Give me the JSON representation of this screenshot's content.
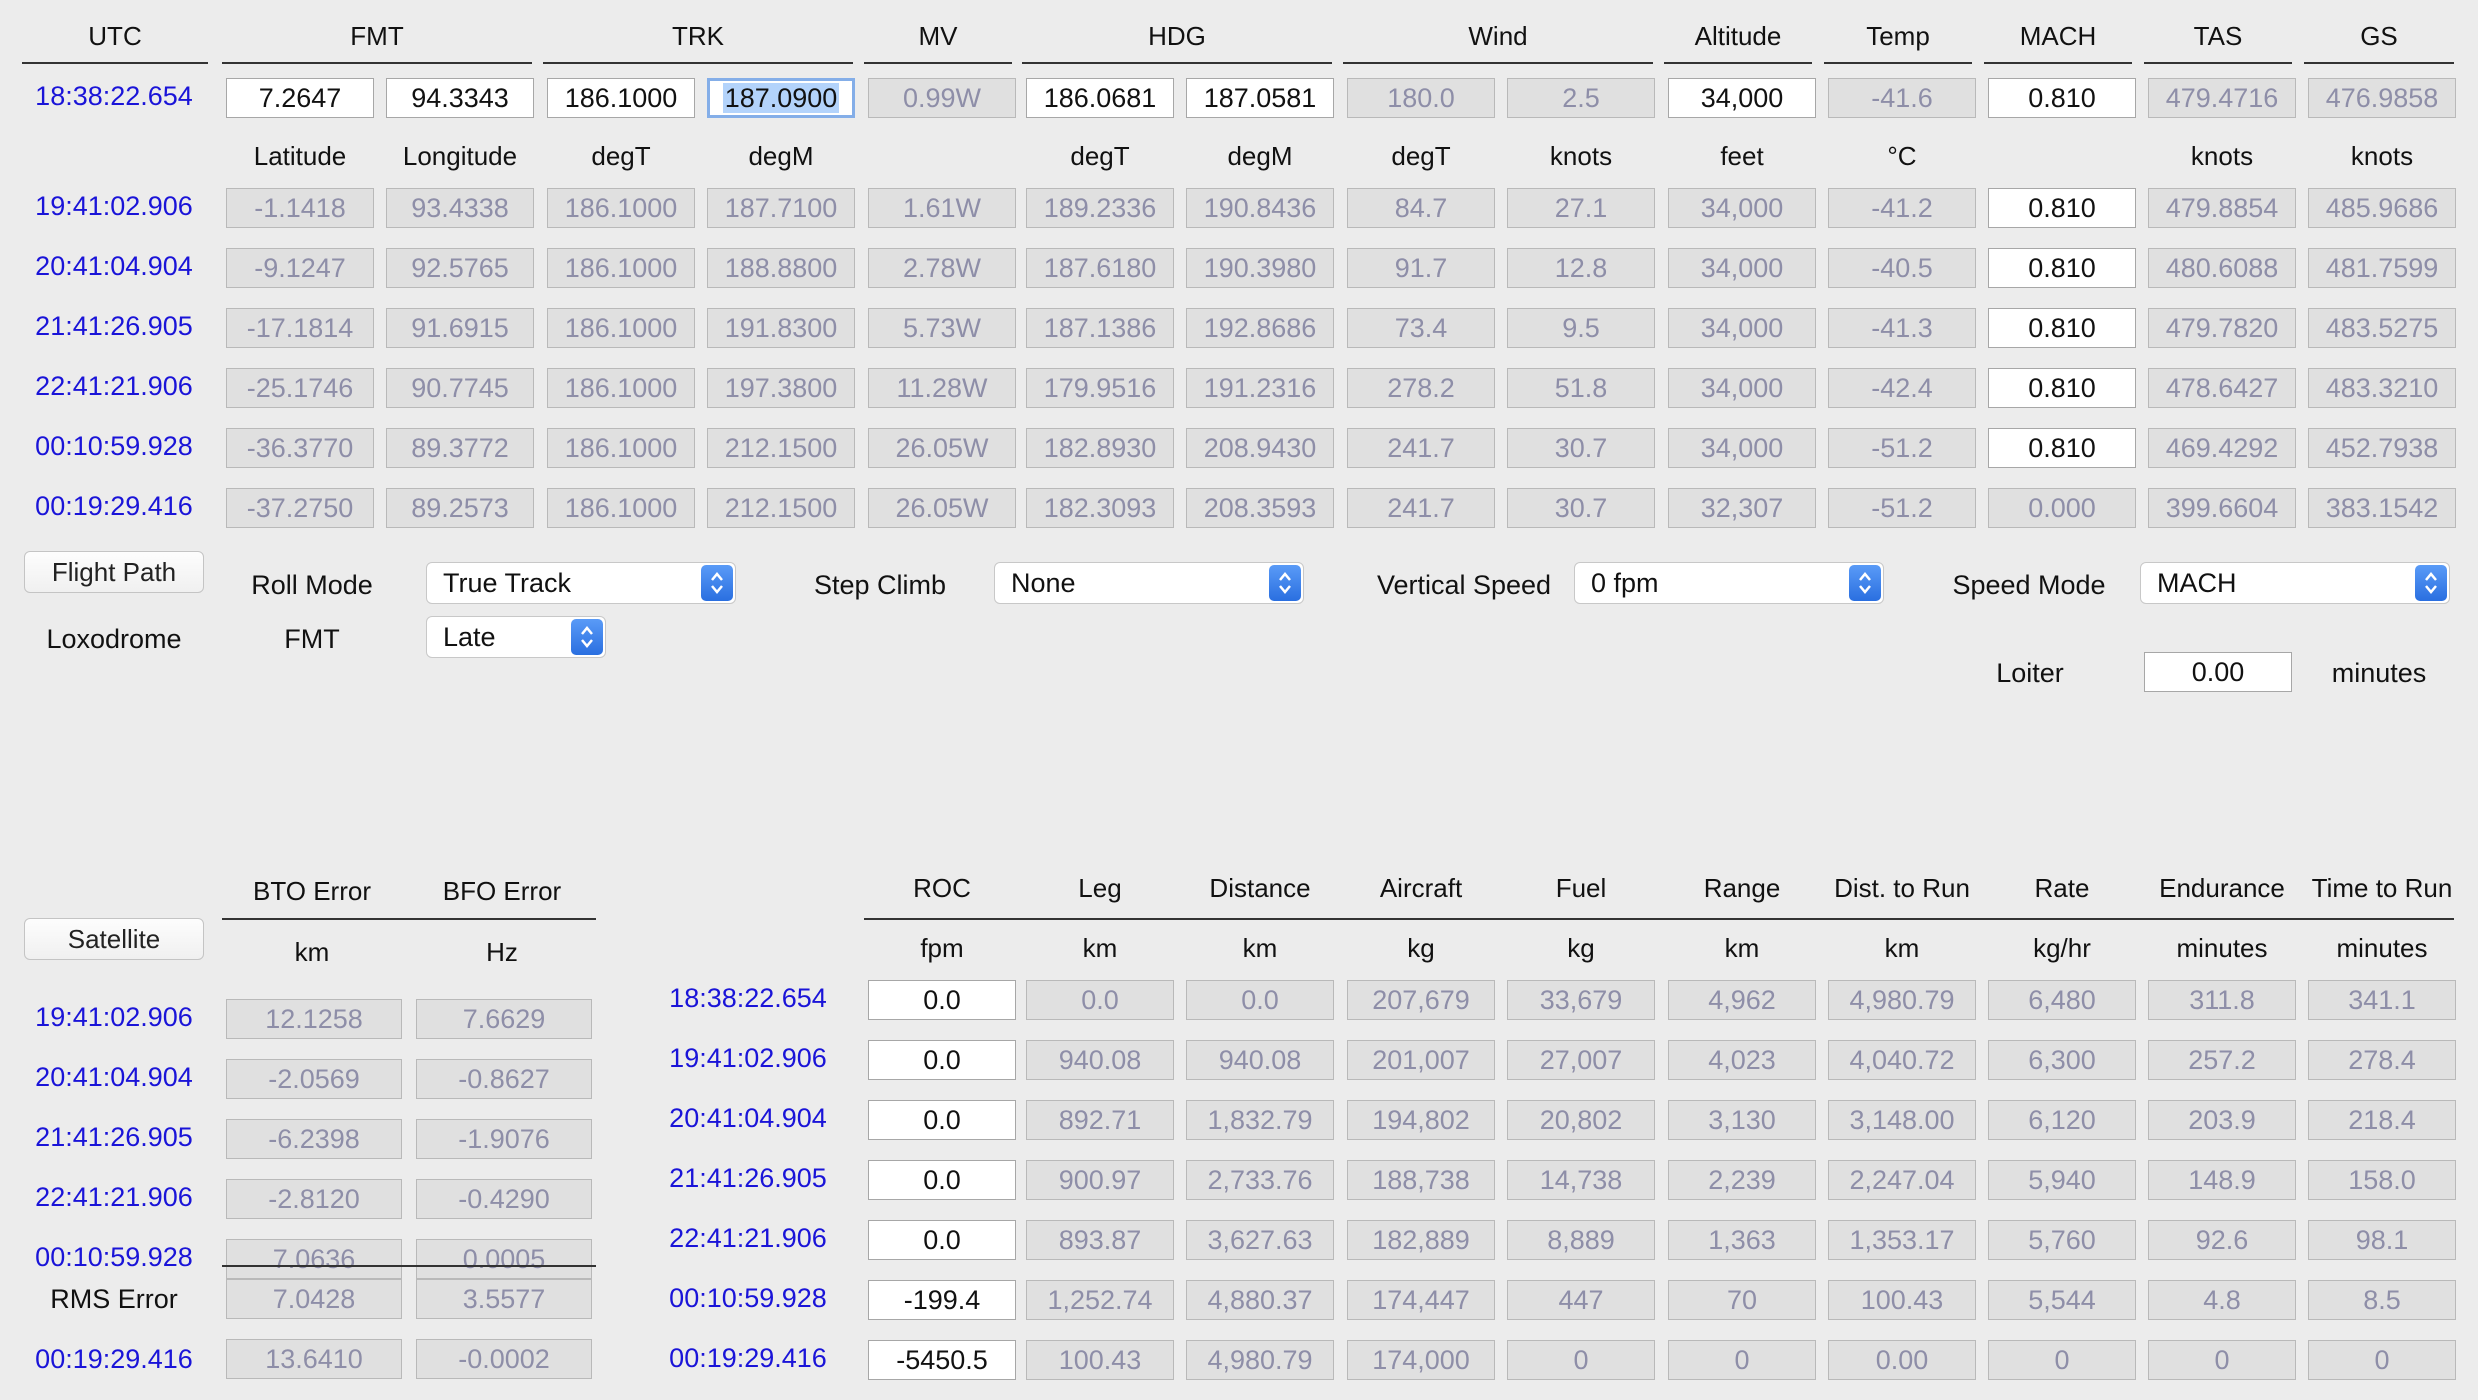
{
  "top_headers": [
    "UTC",
    "FMT",
    "TRK",
    "MV",
    "HDG",
    "Wind",
    "Altitude",
    "Temp",
    "MACH",
    "TAS",
    "GS"
  ],
  "top_units": [
    "Latitude",
    "Longitude",
    "degT",
    "degM",
    "",
    "degT",
    "degM",
    "degT",
    "knots",
    "feet",
    "°C",
    "",
    "knots",
    "knots"
  ],
  "top_rows": [
    {
      "time": "18:38:22.654",
      "cells": [
        "7.2647",
        "94.3343",
        "186.1000",
        "187.0900",
        "0.99W",
        "186.0681",
        "187.0581",
        "180.0",
        "2.5",
        "34,000",
        "-41.6",
        "0.810",
        "479.4716",
        "476.9858"
      ]
    },
    {
      "time": "19:41:02.906",
      "cells": [
        "-1.1418",
        "93.4338",
        "186.1000",
        "187.7100",
        "1.61W",
        "189.2336",
        "190.8436",
        "84.7",
        "27.1",
        "34,000",
        "-41.2",
        "0.810",
        "479.8854",
        "485.9686"
      ]
    },
    {
      "time": "20:41:04.904",
      "cells": [
        "-9.1247",
        "92.5765",
        "186.1000",
        "188.8800",
        "2.78W",
        "187.6180",
        "190.3980",
        "91.7",
        "12.8",
        "34,000",
        "-40.5",
        "0.810",
        "480.6088",
        "481.7599"
      ]
    },
    {
      "time": "21:41:26.905",
      "cells": [
        "-17.1814",
        "91.6915",
        "186.1000",
        "191.8300",
        "5.73W",
        "187.1386",
        "192.8686",
        "73.4",
        "9.5",
        "34,000",
        "-41.3",
        "0.810",
        "479.7820",
        "483.5275"
      ]
    },
    {
      "time": "22:41:21.906",
      "cells": [
        "-25.1746",
        "90.7745",
        "186.1000",
        "197.3800",
        "11.28W",
        "179.9516",
        "191.2316",
        "278.2",
        "51.8",
        "34,000",
        "-42.4",
        "0.810",
        "478.6427",
        "483.3210"
      ]
    },
    {
      "time": "00:10:59.928",
      "cells": [
        "-36.3770",
        "89.3772",
        "186.1000",
        "212.1500",
        "26.05W",
        "182.8930",
        "208.9430",
        "241.7",
        "30.7",
        "34,000",
        "-51.2",
        "0.810",
        "469.4292",
        "452.7938"
      ]
    },
    {
      "time": "00:19:29.416",
      "cells": [
        "-37.2750",
        "89.2573",
        "186.1000",
        "212.1500",
        "26.05W",
        "182.3093",
        "208.3593",
        "241.7",
        "30.7",
        "32,307",
        "-51.2",
        "0.000",
        "399.6604",
        "383.1542"
      ]
    }
  ],
  "controls": {
    "flight_path_button": "Flight Path",
    "loxodrome_label": "Loxodrome",
    "roll_mode_label": "Roll Mode",
    "roll_mode_value": "True Track",
    "fmt_label": "FMT",
    "fmt_value": "Late",
    "step_climb_label": "Step Climb",
    "step_climb_value": "None",
    "vertical_speed_label": "Vertical Speed",
    "vertical_speed_value": "0 fpm",
    "speed_mode_label": "Speed Mode",
    "speed_mode_value": "MACH",
    "loiter_label": "Loiter",
    "loiter_value": "0.00",
    "loiter_unit": "minutes"
  },
  "satellite": {
    "button": "Satellite",
    "headers": [
      "BTO Error",
      "BFO Error"
    ],
    "units": [
      "km",
      "Hz"
    ],
    "rows": [
      {
        "time": "19:41:02.906",
        "cells": [
          "12.1258",
          "7.6629"
        ]
      },
      {
        "time": "20:41:04.904",
        "cells": [
          "-2.0569",
          "-0.8627"
        ]
      },
      {
        "time": "21:41:26.905",
        "cells": [
          "-6.2398",
          "-1.9076"
        ]
      },
      {
        "time": "22:41:21.906",
        "cells": [
          "-2.8120",
          "-0.4290"
        ]
      },
      {
        "time": "00:10:59.928",
        "cells": [
          "7.0636",
          "0.0005"
        ]
      }
    ],
    "rms_label": "RMS Error",
    "rms_cells": [
      "7.0428",
      "3.5577"
    ],
    "last_time": "00:19:29.416",
    "last_cells": [
      "13.6410",
      "-0.0002"
    ]
  },
  "fuel": {
    "headers": [
      "ROC",
      "Leg",
      "Distance",
      "Aircraft",
      "Fuel",
      "Range",
      "Dist. to Run",
      "Rate",
      "Endurance",
      "Time to Run"
    ],
    "units": [
      "fpm",
      "km",
      "km",
      "kg",
      "kg",
      "km",
      "km",
      "kg/hr",
      "minutes",
      "minutes"
    ],
    "rows": [
      {
        "time": "18:38:22.654",
        "cells": [
          "0.0",
          "0.0",
          "0.0",
          "207,679",
          "33,679",
          "4,962",
          "4,980.79",
          "6,480",
          "311.8",
          "341.1"
        ]
      },
      {
        "time": "19:41:02.906",
        "cells": [
          "0.0",
          "940.08",
          "940.08",
          "201,007",
          "27,007",
          "4,023",
          "4,040.72",
          "6,300",
          "257.2",
          "278.4"
        ]
      },
      {
        "time": "20:41:04.904",
        "cells": [
          "0.0",
          "892.71",
          "1,832.79",
          "194,802",
          "20,802",
          "3,130",
          "3,148.00",
          "6,120",
          "203.9",
          "218.4"
        ]
      },
      {
        "time": "21:41:26.905",
        "cells": [
          "0.0",
          "900.97",
          "2,733.76",
          "188,738",
          "14,738",
          "2,239",
          "2,247.04",
          "5,940",
          "148.9",
          "158.0"
        ]
      },
      {
        "time": "22:41:21.906",
        "cells": [
          "0.0",
          "893.87",
          "3,627.63",
          "182,889",
          "8,889",
          "1,363",
          "1,353.17",
          "5,760",
          "92.6",
          "98.1"
        ]
      },
      {
        "time": "00:10:59.928",
        "cells": [
          "-199.4",
          "1,252.74",
          "4,880.37",
          "174,447",
          "447",
          "70",
          "100.43",
          "5,544",
          "4.8",
          "8.5"
        ]
      },
      {
        "time": "00:19:29.416",
        "cells": [
          "-5450.5",
          "100.43",
          "4,980.79",
          "174,000",
          "0",
          "0",
          "0.00",
          "0",
          "0",
          "0"
        ]
      }
    ]
  }
}
